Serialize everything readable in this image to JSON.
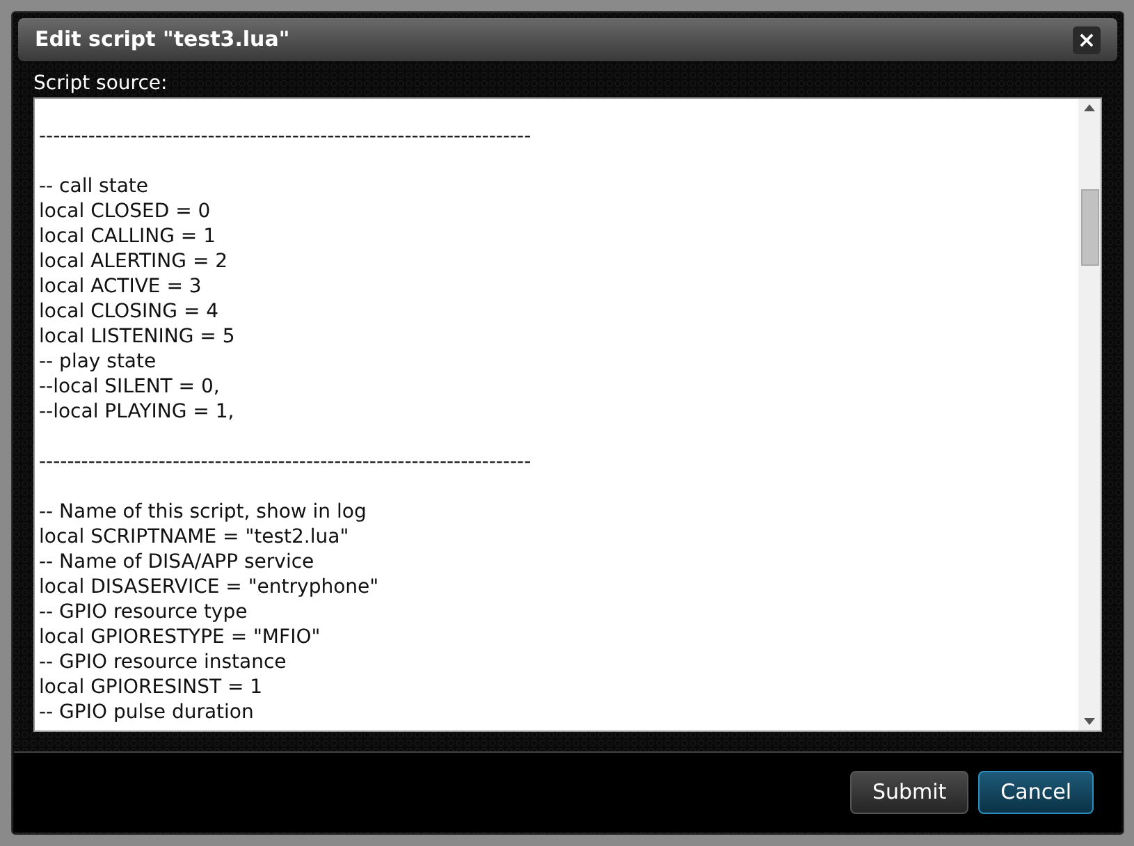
{
  "dialog": {
    "title": "Edit script \"test3.lua\"",
    "close_label": "×"
  },
  "script_source": {
    "label": "Script source:",
    "value": "\n----------------------------------------------------------------------\n\n-- call state\nlocal CLOSED = 0\nlocal CALLING = 1\nlocal ALERTING = 2\nlocal ACTIVE = 3\nlocal CLOSING = 4\nlocal LISTENING = 5\n-- play state\n--local SILENT = 0,\n--local PLAYING = 1,\n\n----------------------------------------------------------------------\n\n-- Name of this script, show in log\nlocal SCRIPTNAME = \"test2.lua\"\n-- Name of DISA/APP service\nlocal DISASERVICE = \"entryphone\"\n-- GPIO resource type\nlocal GPIORESTYPE = \"MFIO\"\n-- GPIO resource instance\nlocal GPIORESINST = 1\n-- GPIO pulse duration"
  },
  "buttons": [
    {
      "label": "Submit",
      "kind": "default"
    },
    {
      "label": "Cancel",
      "kind": "primary"
    }
  ]
}
